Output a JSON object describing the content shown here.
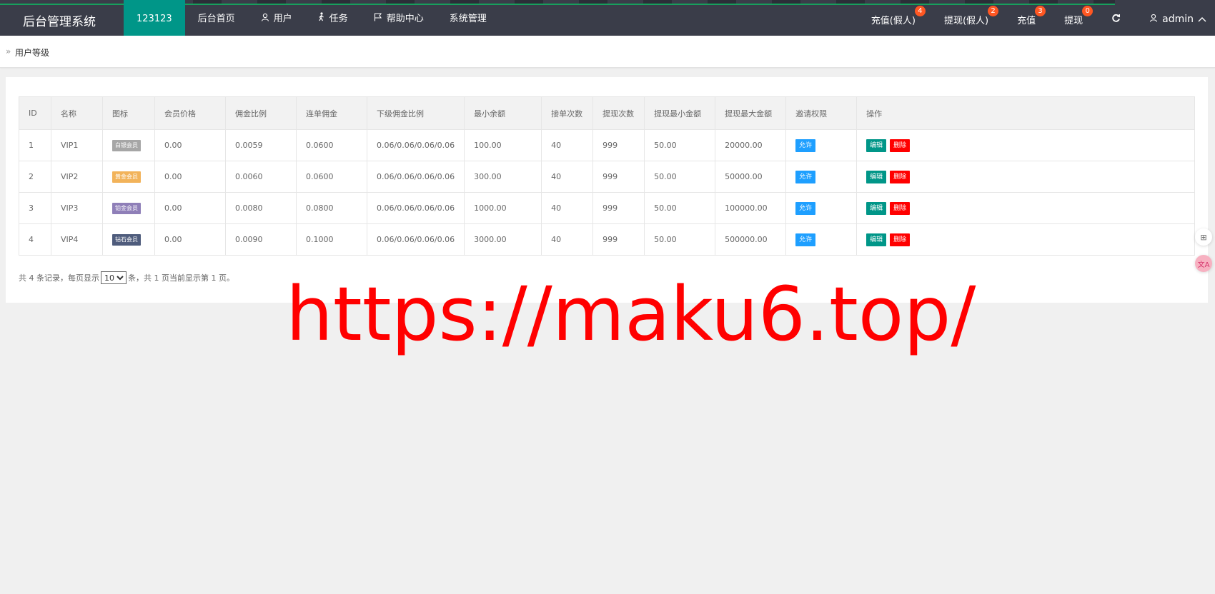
{
  "header": {
    "app_title": "后台管理系统",
    "nav": [
      {
        "label": "123123",
        "icon": ""
      },
      {
        "label": "后台首页",
        "icon": ""
      },
      {
        "label": "用户",
        "icon": "user-icon"
      },
      {
        "label": "任务",
        "icon": "walker-icon"
      },
      {
        "label": "帮助中心",
        "icon": "flag-icon"
      },
      {
        "label": "系统管理",
        "icon": ""
      }
    ],
    "right": [
      {
        "label": "充值(假人)",
        "badge": "4"
      },
      {
        "label": "提现(假人)",
        "badge": "2"
      },
      {
        "label": "充值",
        "badge": "3"
      },
      {
        "label": "提现",
        "badge": "0"
      }
    ],
    "refresh_icon": "refresh-icon",
    "user": {
      "name": "admin",
      "icon": "user-icon",
      "caret": "chevron-up-icon"
    }
  },
  "breadcrumb": {
    "separator": "»",
    "current": "用户等级"
  },
  "table": {
    "columns": [
      "ID",
      "名称",
      "图标",
      "会员价格",
      "佣金比例",
      "连单佣金",
      "下级佣金比例",
      "最小余额",
      "接单次数",
      "提现次数",
      "提现最小金额",
      "提现最大金额",
      "邀请权限",
      "操作"
    ],
    "rows": [
      {
        "id": "1",
        "name": "VIP1",
        "icon_label": "白银会员",
        "icon_color": "#a6a6a6",
        "price": "0.00",
        "commission": "0.0059",
        "chain_commission": "0.0600",
        "sub_commission": "0.06/0.06/0.06/0.06",
        "min_balance": "100.00",
        "orders": "40",
        "withdraw_times": "999",
        "withdraw_min": "50.00",
        "withdraw_max": "20000.00",
        "invite": "允许",
        "edit": "编辑",
        "delete": "删除"
      },
      {
        "id": "2",
        "name": "VIP2",
        "icon_label": "黄金会员",
        "icon_color": "#f2b35a",
        "price": "0.00",
        "commission": "0.0060",
        "chain_commission": "0.0600",
        "sub_commission": "0.06/0.06/0.06/0.06",
        "min_balance": "300.00",
        "orders": "40",
        "withdraw_times": "999",
        "withdraw_min": "50.00",
        "withdraw_max": "50000.00",
        "invite": "允许",
        "edit": "编辑",
        "delete": "删除"
      },
      {
        "id": "3",
        "name": "VIP3",
        "icon_label": "铂金会员",
        "icon_color": "#8f7fb8",
        "price": "0.00",
        "commission": "0.0080",
        "chain_commission": "0.0800",
        "sub_commission": "0.06/0.06/0.06/0.06",
        "min_balance": "1000.00",
        "orders": "40",
        "withdraw_times": "999",
        "withdraw_min": "50.00",
        "withdraw_max": "100000.00",
        "invite": "允许",
        "edit": "编辑",
        "delete": "删除"
      },
      {
        "id": "4",
        "name": "VIP4",
        "icon_label": "钻石会员",
        "icon_color": "#4f5c7c",
        "price": "0.00",
        "commission": "0.0090",
        "chain_commission": "0.1000",
        "sub_commission": "0.06/0.06/0.06/0.06",
        "min_balance": "3000.00",
        "orders": "40",
        "withdraw_times": "999",
        "withdraw_min": "50.00",
        "withdraw_max": "500000.00",
        "invite": "允许",
        "edit": "编辑",
        "delete": "删除"
      }
    ]
  },
  "pager": {
    "prefix": "共 4 条记录，每页显示",
    "page_size": "10",
    "suffix": "条，共 1 页当前显示第 1 页。"
  },
  "floating": [
    {
      "label": "⊞",
      "icon": "apps-icon"
    },
    {
      "label": "文A",
      "icon": "translate-icon"
    }
  ],
  "watermark": "https://maku6.top/",
  "colors": {
    "header_bg": "#3a3d49",
    "active": "#009688",
    "badge": "#ff5722",
    "allow": "#1e9fff",
    "edit": "#009688",
    "delete": "#ff0000",
    "watermark": "#ff0000"
  }
}
